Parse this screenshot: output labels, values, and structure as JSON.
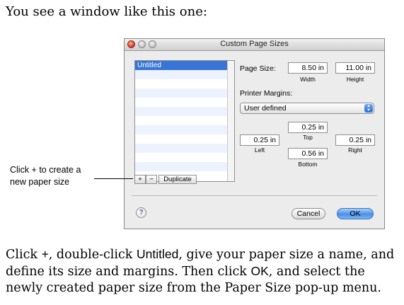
{
  "intro_text": "You see a window like this one:",
  "callout": {
    "line1": "Click + to create a",
    "line2": "new paper size"
  },
  "paragraph": {
    "p1": "Click ",
    "plus": "+",
    "p2": ", double-click ",
    "untitled": "Untitled",
    "p3": ", give your paper size a name, and define its size and margins. Then click ",
    "ok": "OK",
    "p4": ", and select the newly created paper size from the Paper Size pop-up menu."
  },
  "window": {
    "title": "Custom Page Sizes",
    "list": {
      "selected": "Untitled",
      "rows": [
        "Untitled",
        "",
        "",
        "",
        "",
        "",
        "",
        "",
        "",
        "",
        "",
        "",
        ""
      ]
    },
    "buttons": {
      "add": "+",
      "remove": "−",
      "duplicate": "Duplicate",
      "cancel": "Cancel",
      "ok": "OK",
      "help": "?"
    },
    "page_size": {
      "label": "Page Size:",
      "width": "8.50 in",
      "height": "11.00 in",
      "width_label": "Width",
      "height_label": "Height"
    },
    "margins": {
      "label": "Printer Margins:",
      "selected": "User defined",
      "top": "0.25 in",
      "left": "0.25 in",
      "right": "0.25 in",
      "bottom": "0.56 in",
      "top_label": "Top",
      "left_label": "Left",
      "right_label": "Right",
      "bottom_label": "Bottom"
    },
    "colors": {
      "selection": "#3875d7",
      "ok_button": "#4a8fe8",
      "window_bg": "#ececec"
    }
  }
}
